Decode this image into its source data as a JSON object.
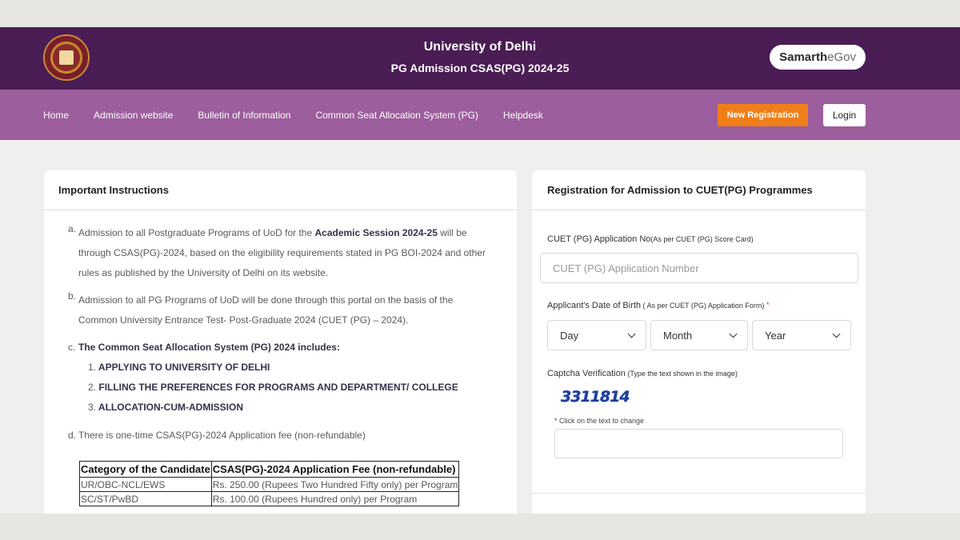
{
  "header": {
    "title": "University of Delhi",
    "subtitle": "PG Admission CSAS(PG) 2024-25",
    "brand_part1": "Samarth",
    "brand_part2": "eGov",
    "logo_icon": "university-of-delhi-seal"
  },
  "nav": {
    "items": [
      "Home",
      "Admission website",
      "Bulletin of Information",
      "Common Seat Allocation System (PG)",
      "Helpdesk"
    ],
    "new_registration": "New Registration",
    "login": "Login"
  },
  "instructions": {
    "heading": "Important Instructions",
    "a_mark": "a.",
    "a_text_1": "Admission to all Postgraduate Programs of UoD for the ",
    "a_bold": "Academic Session 2024-25",
    "a_text_2": " will be through CSAS(PG)-2024, based on the eligibility requirements stated in PG BOI-2024 and other rules as published by the University of Delhi on its website.",
    "b_mark": "b.",
    "b_text": "Admission to all PG Programs of UoD will be done through this portal on the basis of the Common University Entrance Test- Post-Graduate 2024 (CUET (PG) – 2024).",
    "c_mark": "c.",
    "c_text": "The Common Seat Allocation System (PG) 2024 includes:",
    "c_sub": [
      {
        "num": "1.",
        "text": "APPLYING TO UNIVERSITY OF DELHI"
      },
      {
        "num": "2.",
        "text": "FILLING THE PREFERENCES FOR PROGRAMS AND DEPARTMENT/ COLLEGE"
      },
      {
        "num": "3.",
        "text": "ALLOCATION-CUM-ADMISSION"
      }
    ],
    "d_mark": "d.",
    "d_text": "There is one-time CSAS(PG)-2024 Application fee  (non-refundable)"
  },
  "fee_table": {
    "headers": [
      "Category of the Candidate",
      "CSAS(PG)-2024 Application Fee (non-refundable)"
    ],
    "rows": [
      [
        "UR/OBC-NCL/EWS",
        "Rs. 250.00 (Rupees Two Hundred Fifty only) per Program"
      ],
      [
        "SC/ST/PwBD",
        "Rs. 100.00 (Rupees Hundred only) per Program"
      ]
    ]
  },
  "registration": {
    "heading": "Registration for Admission to CUET(PG) Programmes",
    "app_no_label": "CUET (PG) Application No",
    "app_no_hint": "(As per CUET (PG) Score Card)",
    "app_no_placeholder": "CUET (PG) Application Number",
    "dob_label": "Applicant's Date of Birth",
    "dob_hint": " ( As per CUET (PG) Application Form) ",
    "required_mark": "*",
    "day": "Day",
    "month": "Month",
    "year": "Year",
    "captcha_label": "Captcha Verification",
    "captcha_hint": " (Type the text shown in the image)",
    "captcha_text": "3311814",
    "captcha_note": "* Click on the text to change"
  }
}
